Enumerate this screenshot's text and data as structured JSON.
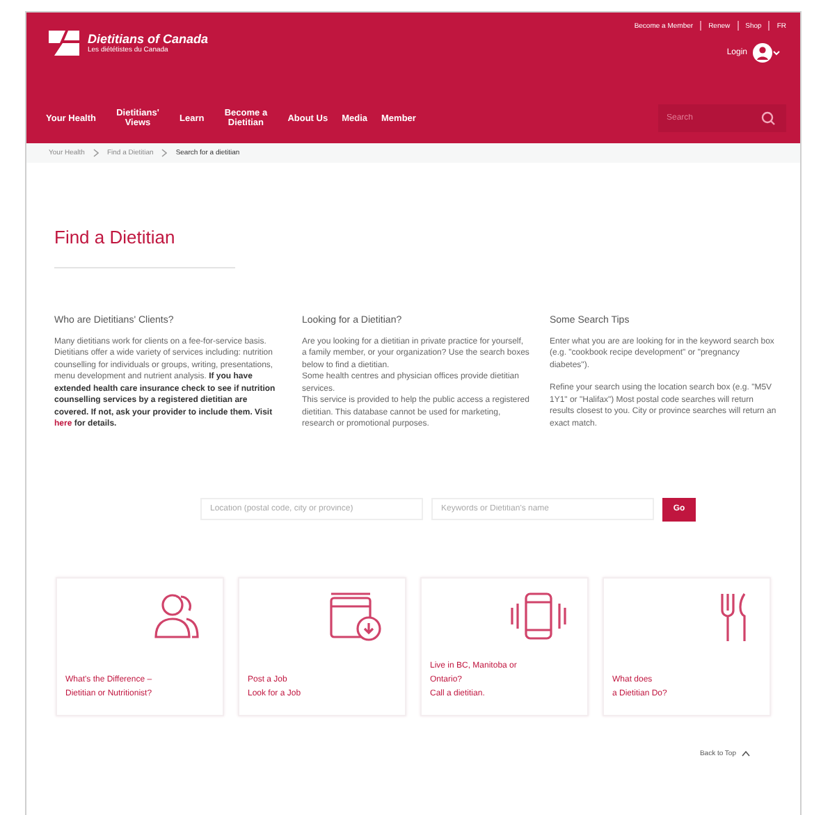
{
  "header": {
    "site_name": "Dietitians of Canada",
    "site_subname": "Les diététistes du Canada",
    "top_links": [
      "Become a Member",
      "Renew",
      "Shop",
      "FR"
    ],
    "login": "Login"
  },
  "nav": {
    "items": [
      "Your Health",
      "Dietitians' Views",
      "Learn",
      "Become a Dietitian",
      "About Us",
      "Media",
      "Member"
    ],
    "search_placeholder": "Search"
  },
  "breadcrumb": [
    "Your Health",
    "Find a Dietitian",
    "Search for a dietitian"
  ],
  "page_title": "Find a Dietitian",
  "columns": [
    {
      "heading": "Who are Dietitians' Clients?",
      "paragraphs": [
        {
          "text": "Many dietitians work for clients on a fee-for-service basis. Dietitians offer a wide variety of services including: nutrition counselling for individuals or groups, writing, presentations, menu development and nutrient analysis. **If you have extended health care insurance check to see if nutrition counselling services by a registered dietitian are covered. If not, ask your provider to include them. Visit**",
          "link": "here",
          "after": "**for details.**"
        }
      ]
    },
    {
      "heading": "Looking for a Dietitian?",
      "paragraphs": [
        {
          "text": "Are you looking for a dietitian in private practice for yourself, a family member, or your organization? Use the search boxes below to find a dietitian."
        },
        {
          "text": "Some health centres and physician offices provide dietitian services."
        },
        {
          "text": "This service is provided to help the public access a registered dietitian. This database cannot be used for marketing, research or promotional purposes."
        }
      ]
    },
    {
      "heading": "Some Search Tips",
      "paragraphs": [
        {
          "text": "Enter what you are are looking for in the keyword search box (e.g. \"cookbook recipe development\" or \"pregnancy diabetes\")."
        },
        {
          "text": "Refine your search using the location search box (e.g. \"M5V 1Y1\" or \"Halifax\") Most postal code searches will return results closest to you. City or province searches will return an exact match."
        }
      ]
    }
  ],
  "search": {
    "location_placeholder": "Location (postal code, city or province)",
    "keyword_placeholder": "Keywords or Dietitian's name",
    "button": "Go"
  },
  "cards": [
    {
      "kind": "people",
      "lines": [
        "What's the Difference –",
        "Dietitian or Nutritionist?"
      ]
    },
    {
      "kind": "calendar",
      "lines": [
        "Post a Job",
        "Look for a Job"
      ]
    },
    {
      "kind": "phone",
      "lines": [
        "Live in BC, Manitoba or",
        "Ontario?",
        "Call a dietitian."
      ]
    },
    {
      "kind": "cutlery",
      "lines": [
        "What does",
        "a Dietitian Do?"
      ]
    }
  ],
  "back_to_top": "Back to Top"
}
